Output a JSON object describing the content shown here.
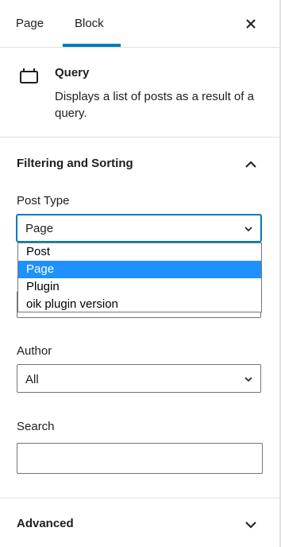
{
  "tabs": [
    {
      "label": "Page",
      "active": false
    },
    {
      "label": "Block",
      "active": true
    }
  ],
  "header": {
    "close_icon": "close-icon",
    "accent": "#007cba"
  },
  "block": {
    "icon": "query-loop-icon",
    "title": "Query",
    "description": "Displays a list of posts as a result of a query."
  },
  "filtering": {
    "title": "Filtering and Sorting",
    "expanded": true,
    "post_type": {
      "label": "Post Type",
      "value": "Page",
      "options": [
        "Post",
        "Page",
        "Plugin",
        "oik plugin version"
      ],
      "highlighted": "Page",
      "highlight_color": "#1e90ff"
    },
    "author": {
      "label": "Author",
      "value": "All"
    },
    "search": {
      "label": "Search",
      "value": "",
      "placeholder": ""
    }
  },
  "advanced": {
    "title": "Advanced",
    "expanded": false
  }
}
